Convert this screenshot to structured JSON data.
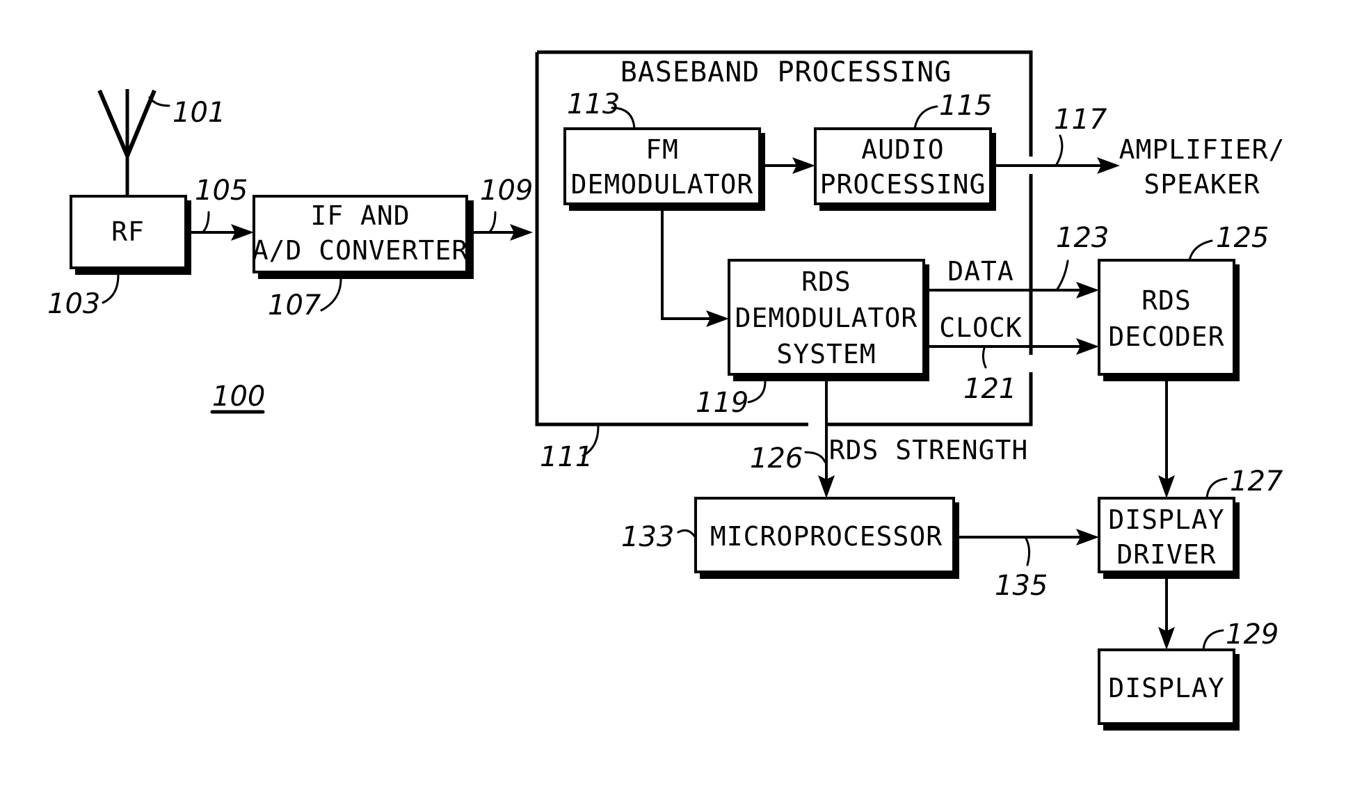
{
  "figure": {
    "reference": "100",
    "antenna": {
      "ref": "101"
    },
    "blocks": {
      "rf": {
        "lines": [
          "RF"
        ],
        "ref": "103"
      },
      "if_ad": {
        "lines": [
          "IF AND",
          "A/D CONVERTER"
        ],
        "ref": "107"
      },
      "baseband": {
        "title": "BASEBAND PROCESSING",
        "ref": "111"
      },
      "fm_demod": {
        "lines": [
          "FM",
          "DEMODULATOR"
        ],
        "ref": "113"
      },
      "audio": {
        "lines": [
          "AUDIO",
          "PROCESSING"
        ],
        "ref": "115"
      },
      "rds_demod": {
        "lines": [
          "RDS",
          "DEMODULATOR",
          "SYSTEM"
        ],
        "ref": "119"
      },
      "rds_decoder": {
        "lines": [
          "RDS",
          "DECODER"
        ],
        "ref": "125"
      },
      "display_driver": {
        "lines": [
          "DISPLAY",
          "DRIVER"
        ],
        "ref": "127"
      },
      "display": {
        "lines": [
          "DISPLAY"
        ],
        "ref": "129"
      },
      "microprocessor": {
        "lines": [
          "MICROPROCESSOR"
        ],
        "ref": "133"
      }
    },
    "signals": {
      "rf_to_if": {
        "ref": "105"
      },
      "if_to_baseband": {
        "ref": "109"
      },
      "audio_out": {
        "ref": "117",
        "dest_lines": [
          "AMPLIFIER/",
          "SPEAKER"
        ]
      },
      "data": {
        "label": "DATA",
        "ref": "123"
      },
      "clock": {
        "label": "CLOCK",
        "ref": "121"
      },
      "rds_strength": {
        "label": "RDS STRENGTH",
        "ref": "126"
      },
      "micro_to_driver": {
        "ref": "135"
      }
    }
  }
}
